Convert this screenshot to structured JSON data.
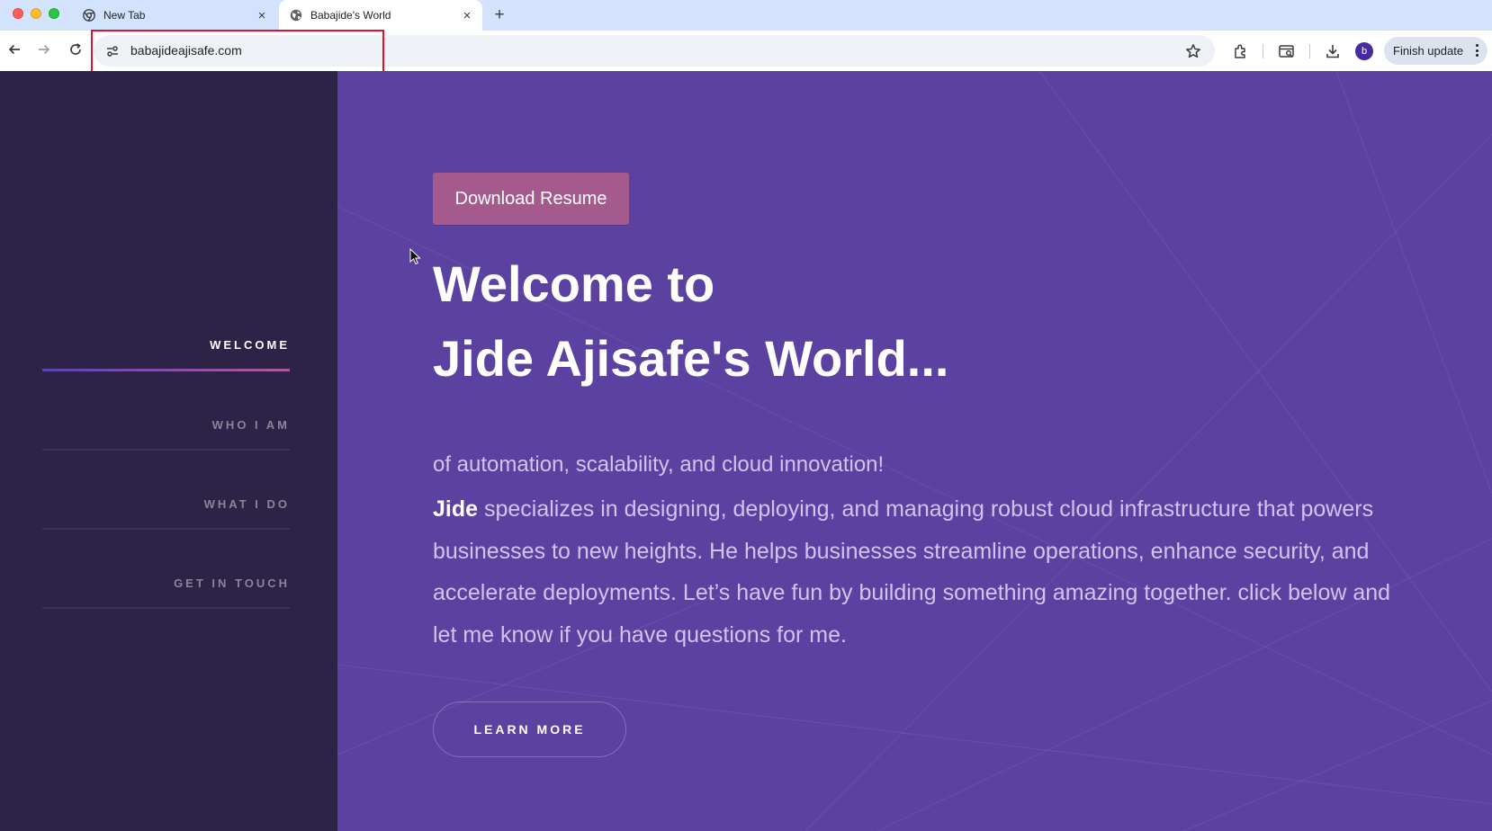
{
  "browser": {
    "tabs": [
      {
        "title": "New Tab",
        "close": "×"
      },
      {
        "title": "Babajide's World",
        "close": "×"
      }
    ],
    "new_tab": "+",
    "url": "babajideajisafe.com",
    "profile_initial": "b",
    "finish_update_label": "Finish update"
  },
  "sidebar": {
    "items": [
      {
        "label": "WELCOME",
        "active": true
      },
      {
        "label": "WHO I AM",
        "active": false
      },
      {
        "label": "WHAT I DO",
        "active": false
      },
      {
        "label": "GET IN TOUCH",
        "active": false
      }
    ]
  },
  "hero": {
    "resume_button": "Download Resume",
    "headline_line1": "Welcome to",
    "headline_line2": "Jide Ajisafe's World...",
    "subtitle": "of automation, scalability, and cloud innovation!",
    "bio_name": "Jide",
    "bio_text": " specializes in designing, deploying, and managing robust cloud infrastructure that powers businesses to new heights. He helps businesses streamline operations, enhance security, and accelerate deployments. Let’s have fun by building something amazing together. click below and let me know if you have questions for me.",
    "learn_more_button": "LEARN MORE"
  },
  "colors": {
    "sidebar_bg": "#2c2346",
    "main_bg": "#5b41a0",
    "accent_button": "#a55a8e",
    "highlight_box": "#e3102b"
  },
  "icons": [
    "chrome-icon",
    "globe-icon",
    "back-arrow-icon",
    "forward-arrow-icon",
    "reload-icon",
    "site-info-icon",
    "star-icon",
    "extensions-icon",
    "tab-search-icon",
    "download-icon",
    "kebab-menu-icon",
    "cursor-icon"
  ]
}
